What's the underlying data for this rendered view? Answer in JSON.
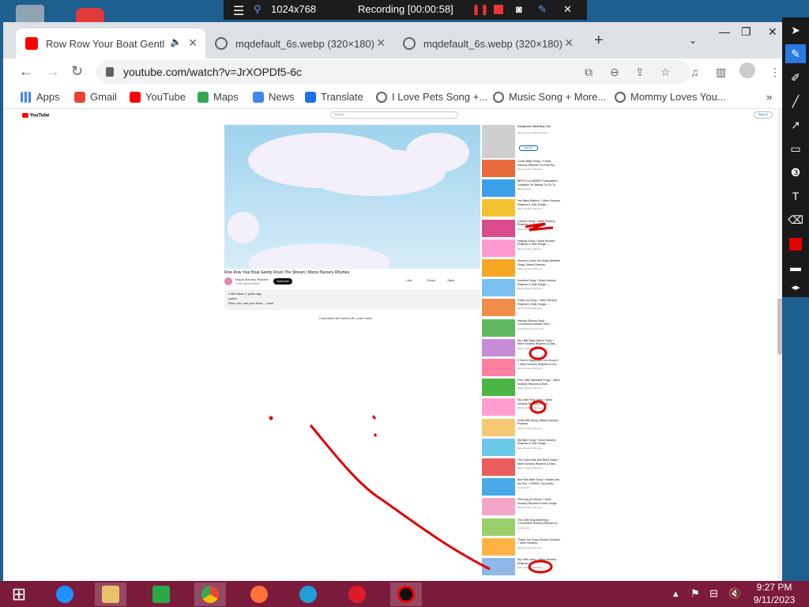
{
  "recorder": {
    "resolution": "1024x768",
    "status": "Recording [00:00:58]"
  },
  "browser": {
    "tabs": [
      {
        "label": "Row Row Your Boat Gently D"
      },
      {
        "label": "mqdefault_6s.webp (320×180)"
      },
      {
        "label": "mqdefault_6s.webp (320×180)"
      }
    ],
    "new_tab": "+",
    "url": "youtube.com/watch?v=JrXOPDf5-6c",
    "bookmarks": [
      {
        "label": "Apps",
        "icon": "apps-grid-icon"
      },
      {
        "label": "Gmail",
        "icon": "gmail-icon"
      },
      {
        "label": "YouTube",
        "icon": "youtube-icon"
      },
      {
        "label": "Maps",
        "icon": "maps-icon"
      },
      {
        "label": "News",
        "icon": "news-icon"
      },
      {
        "label": "Translate",
        "icon": "translate-icon"
      },
      {
        "label": "I Love Pets Song +...",
        "icon": "globe-icon"
      },
      {
        "label": "Music Song + More...",
        "icon": "globe-icon"
      },
      {
        "label": "Mommy Loves You...",
        "icon": "globe-icon"
      }
    ],
    "bookmarks_overflow": "»"
  },
  "youtube": {
    "logo": "YouTube",
    "search_placeholder": "Search",
    "sign_in": "Sign in",
    "video_title": "Row Row Your Boat Gently Down The Stream | Marys Nursery Rhymes",
    "channel_name": "Marys Nursery Rhymes",
    "channel_subs": "1.4M subscribers",
    "subscribe": "Subscribe",
    "actions": [
      "Like",
      "Share",
      "Save"
    ],
    "views": "2.6M views 2 years ago",
    "desc_line1": "Lyrics:",
    "desc_line2": "Row, row, row your boat ... more",
    "comments_off": "Comments are turned off. Learn more",
    "ad": {
      "title": "Dangerous Marketing Tool",
      "meta": "Tally all your marketing tools",
      "button": "Visit site"
    },
    "recommended": [
      {
        "title": "Lucas Baby Song + Funny Nursery Rhymes For Kids By...",
        "meta": "Marys Nursery Rhymes"
      },
      {
        "title": "BEST LULLABIES Compilation | Lullabies For Babies To Go To...",
        "meta": "Baby Lullaby"
      },
      {
        "title": "Yes Baby Balloon + More Nursery Rhymes & Kids Songs -...",
        "meta": "Marys Nursery Rhymes"
      },
      {
        "title": "Unicorn Song + More Nursery Rhymes & Kids Songs",
        "meta": "Marys Nursery Rhymes"
      },
      {
        "title": "Helping Song + More Nursery Rhymes & Kids Songs -...",
        "meta": "Marys Nursery Rhymes"
      },
      {
        "title": "Mommy Loves You Baby Bedtime Song | Marys Nursery...",
        "meta": "Marys Nursery Rhymes"
      },
      {
        "title": "Vacation Song + More Nursery Rhymes & Kids Songs -...",
        "meta": "Marys Nursery Rhymes"
      },
      {
        "title": "Clean Up Song + More Nursery Rhymes & Kids Songs -...",
        "meta": "Marys Nursery Rhymes"
      },
      {
        "title": "Hickory Dickory Dock - CoComelon Animal Time |...",
        "meta": "CoComelon Animal Time"
      },
      {
        "title": "My Little Baby Dance Party + More Nursery Rhymes & Kids...",
        "meta": "Marys Nursery Rhymes"
      },
      {
        "title": "If You're Happy And You Know It + More Nursery Rhymes & Kid...",
        "meta": "Marys Nursery Rhymes"
      },
      {
        "title": "Five Little Speckled Frogs + More Nursery Rhymes & Kids...",
        "meta": "Marys Nursery Rhymes"
      },
      {
        "title": "My Little Pony Song + More Nursery Rhymes & Kids...",
        "meta": "Marys Nursery Rhymes"
      },
      {
        "title": "Drink Milk Song | Marys Nursery Rhymes",
        "meta": "Marys Nursery Rhymes"
      },
      {
        "title": "My Bath Song + More Nursery Rhymes & Kids Songs -...",
        "meta": "Marys Nursery Rhymes"
      },
      {
        "title": "The Duck Hide and Seek Song + More Nursery Rhymes & Kids...",
        "meta": "Marys Nursery Rhymes"
      },
      {
        "title": "Bee Bee Bath Song + Hands and the Sun + MORE CoComelo...",
        "meta": "CoComelon"
      },
      {
        "title": "Pink Day at School + More Nursery Rhymes & Kids Songs -...",
        "meta": "Marys Nursery Rhymes"
      },
      {
        "title": "The Little Dog Marching | CoComelon Nursery Rhymes &...",
        "meta": "CoComelon"
      },
      {
        "title": "Thank You Song (School Version) + More Nursery...",
        "meta": "Marys Nursery Rhymes"
      },
      {
        "title": "My Little Lamb + More Nursery Rhymes",
        "meta": "Marys Nursery Rhymes"
      }
    ]
  },
  "taskbar": {
    "time": "9:27 PM",
    "date": "9/11/2023"
  },
  "colors": {
    "taskbar": "#7a1b3c",
    "annotation_red": "#e00000",
    "youtube_red": "#ff0000"
  }
}
